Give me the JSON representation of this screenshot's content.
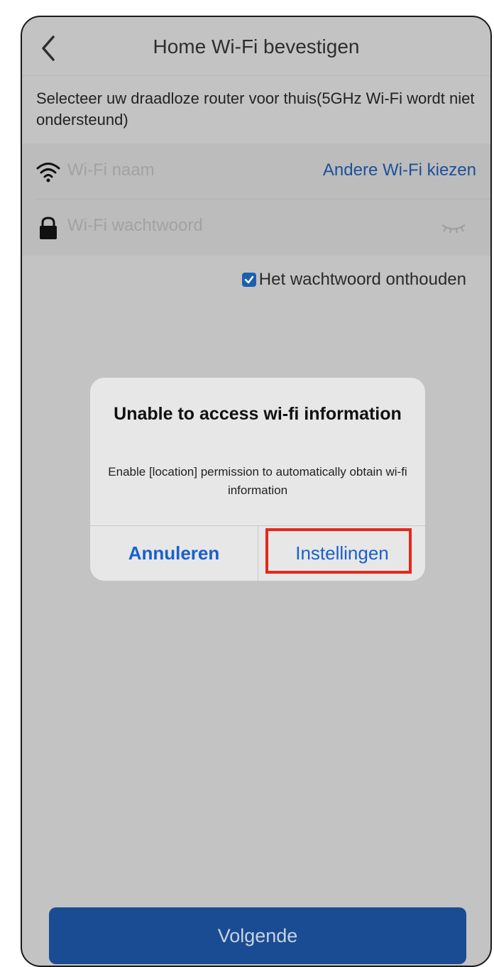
{
  "header": {
    "title": "Home Wi-Fi bevestigen",
    "back_icon": "chevron-left-icon"
  },
  "intro_text": "Selecteer uw draadloze router voor thuis(5GHz Wi-Fi wordt niet ondersteund)",
  "form": {
    "wifi_name": {
      "icon": "wifi-icon",
      "placeholder": "Wi-Fi naam",
      "action_label": "Andere Wi-Fi kiezen"
    },
    "wifi_password": {
      "icon": "lock-icon",
      "placeholder": "Wi-Fi wachtwoord",
      "toggle_icon": "eye-closed-icon"
    },
    "remember": {
      "checked": true,
      "label": "Het wachtwoord onthouden"
    }
  },
  "dialog": {
    "title": "Unable to access wi-fi information",
    "message": "Enable [location] permission to automatically obtain wi-fi information",
    "cancel_label": "Annuleren",
    "settings_label": "Instellingen"
  },
  "footer": {
    "next_label": "Volgende"
  },
  "colors": {
    "accent": "#1b5199",
    "dialog_button": "#1a5fcf",
    "next_button": "#194c93",
    "highlight": "#e8261b",
    "overlay_background": "#c3c3c3"
  }
}
